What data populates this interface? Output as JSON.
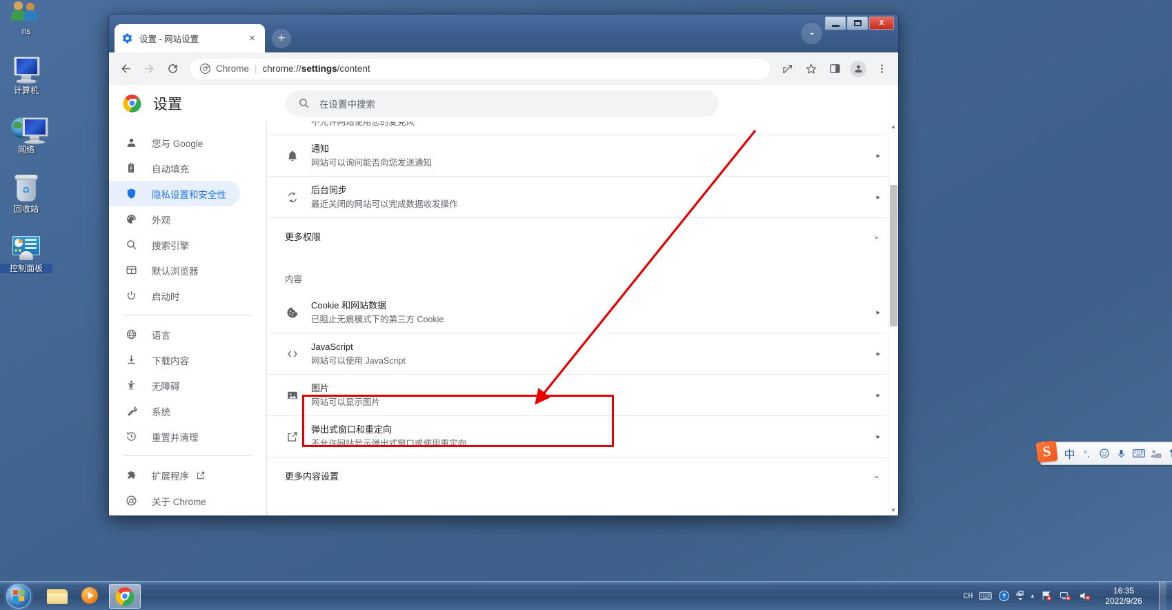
{
  "desktop": {
    "icons": [
      {
        "label": "ns",
        "icon": "people-icon"
      },
      {
        "label": "计算机",
        "icon": "computer-icon"
      },
      {
        "label": "网络",
        "icon": "network-icon"
      },
      {
        "label": "回收站",
        "icon": "recycle-bin-icon"
      },
      {
        "label": "控制面板",
        "icon": "control-panel-icon"
      }
    ]
  },
  "window": {
    "tab": {
      "title": "设置 - 网站设置",
      "favicon": "settings-gear-icon",
      "close": "×"
    },
    "new_tab": "+",
    "controls": {
      "minimize": "minimize-icon",
      "maximize": "maximize-icon",
      "close": "X"
    },
    "toolbar": {
      "back": "←",
      "forward": "→",
      "reload": "⟳",
      "omnibox": {
        "scheme_label": "Chrome",
        "divider": "|",
        "url_plain": "chrome://",
        "url_bold": "settings",
        "url_tail": "/content"
      },
      "share": "share-icon",
      "bookmark": "star-icon",
      "side_panel": "side-panel-icon",
      "profile": "profile-avatar-icon",
      "menu": "three-dot-menu-icon"
    }
  },
  "settings": {
    "title": "设置",
    "search_placeholder": "在设置中搜索",
    "sidebar": [
      {
        "label": "您与 Google",
        "icon": "person-icon",
        "active": false
      },
      {
        "label": "自动填充",
        "icon": "clipboard-icon",
        "active": false
      },
      {
        "label": "隐私设置和安全性",
        "icon": "shield-icon",
        "active": true
      },
      {
        "label": "外观",
        "icon": "palette-icon",
        "active": false
      },
      {
        "label": "搜索引擎",
        "icon": "search-icon",
        "active": false
      },
      {
        "label": "默认浏览器",
        "icon": "browser-window-icon",
        "active": false
      },
      {
        "label": "启动时",
        "icon": "power-icon",
        "active": false
      }
    ],
    "sidebar_group2": [
      {
        "label": "语言",
        "icon": "globe-icon"
      },
      {
        "label": "下载内容",
        "icon": "download-icon"
      },
      {
        "label": "无障碍",
        "icon": "accessibility-icon"
      },
      {
        "label": "系统",
        "icon": "wrench-icon"
      },
      {
        "label": "重置并清理",
        "icon": "history-restore-icon"
      }
    ],
    "sidebar_group3": [
      {
        "label": "扩展程序",
        "icon": "puzzle-icon",
        "external": true
      },
      {
        "label": "关于 Chrome",
        "icon": "chrome-circle-icon",
        "external": false
      }
    ],
    "content": {
      "partial_row": {
        "sub": "不允许网站使用您的麦克风",
        "icon": "microphone-icon"
      },
      "rows_permissions": [
        {
          "title": "通知",
          "sub": "网站可以询问能否向您发送通知",
          "icon": "bell-icon",
          "arrow": "▸"
        },
        {
          "title": "后台同步",
          "sub": "最近关闭的网站可以完成数据收发操作",
          "icon": "sync-icon",
          "arrow": "▸"
        }
      ],
      "more_permissions": {
        "label": "更多权限",
        "chevron": "⌄"
      },
      "content_group_label": "内容",
      "rows_content": [
        {
          "title": "Cookie 和网站数据",
          "sub": "已阻止无痕模式下的第三方 Cookie",
          "icon": "cookie-icon",
          "arrow": "▸"
        },
        {
          "title": "JavaScript",
          "sub": "网站可以使用 JavaScript",
          "icon": "code-brackets-icon",
          "arrow": "▸"
        },
        {
          "title": "图片",
          "sub": "网站可以显示图片",
          "icon": "image-icon",
          "arrow": "▸"
        },
        {
          "title": "弹出式窗口和重定向",
          "sub": "不允许网站显示弹出式窗口或使用重定向",
          "icon": "popup-redirect-icon",
          "arrow": "▸",
          "highlighted": true
        }
      ],
      "more_content_settings": {
        "label": "更多内容设置",
        "chevron": "⌄"
      }
    }
  },
  "annotations": {
    "highlight_color": "#e60000",
    "arrow_color": "#e60000",
    "target_row_label": "弹出式窗口和重定向"
  },
  "ime": {
    "logo": "S",
    "items": [
      {
        "glyph": "中",
        "name": "chinese-mode-icon"
      },
      {
        "glyph": "°,",
        "name": "punctuation-icon"
      },
      {
        "glyph": "☺",
        "name": "emoji-icon"
      },
      {
        "glyph": "🎤",
        "name": "voice-input-icon"
      },
      {
        "glyph": "⌨",
        "name": "soft-keyboard-icon"
      },
      {
        "glyph": "24",
        "name": "user-center-icon"
      },
      {
        "glyph": "👕",
        "name": "skin-icon"
      }
    ]
  },
  "taskbar": {
    "start": "start-orb-icon",
    "pinned": [
      {
        "name": "file-explorer-icon",
        "active": false
      },
      {
        "name": "media-player-icon",
        "active": false
      },
      {
        "name": "chrome-icon",
        "active": true
      }
    ],
    "tray": {
      "lang": "CH",
      "keyboard": "keyboard-icon",
      "help": "?",
      "network_overflow": "overflow-icon",
      "show_hidden": "▴",
      "flag": "flag-warning-icon",
      "network": "network-error-icon",
      "volume": "volume-muted-icon"
    },
    "clock": {
      "time": "16:35",
      "date": "2022/9/26"
    }
  }
}
